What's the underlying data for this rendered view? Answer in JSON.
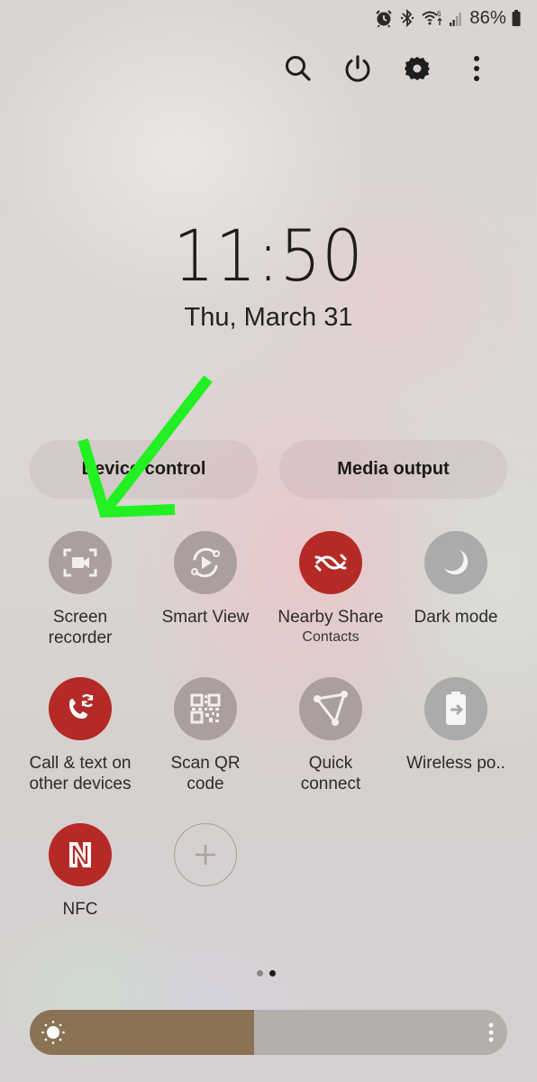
{
  "status_bar": {
    "icons": [
      "alarm-icon",
      "bluetooth-icon",
      "wifi-6-icon",
      "cell-signal-icon",
      "battery-icon"
    ],
    "battery_percent": "86%"
  },
  "top_actions": [
    {
      "icon": "search-icon",
      "label": "Search"
    },
    {
      "icon": "power-icon",
      "label": "Power"
    },
    {
      "icon": "gear-icon",
      "label": "Settings"
    },
    {
      "icon": "more-vert-icon",
      "label": "More options"
    }
  ],
  "clock": {
    "time": "11:50",
    "date": "Thu, March 31"
  },
  "pills": {
    "device_control": "Device control",
    "media_output": "Media output"
  },
  "tiles": [
    {
      "label": "Screen",
      "label2": "recorder",
      "sub": "",
      "icon": "screen-recorder-icon",
      "state": "off"
    },
    {
      "label": "Smart View",
      "label2": "",
      "sub": "",
      "icon": "smart-view-icon",
      "state": "off"
    },
    {
      "label": "Nearby Share",
      "label2": "",
      "sub": "Contacts",
      "icon": "nearby-share-icon",
      "state": "on"
    },
    {
      "label": "Dark mode",
      "label2": "",
      "sub": "",
      "icon": "moon-icon",
      "state": "off"
    },
    {
      "label": "Call & text on",
      "label2": "other devices",
      "sub": "",
      "icon": "call-sync-icon",
      "state": "on"
    },
    {
      "label": "Scan QR",
      "label2": "code",
      "sub": "",
      "icon": "qr-code-icon",
      "state": "off"
    },
    {
      "label": "Quick",
      "label2": "connect",
      "sub": "",
      "icon": "quick-connect-icon",
      "state": "off"
    },
    {
      "label": "Wireless po..",
      "label2": "",
      "sub": "",
      "icon": "wireless-powershare-icon",
      "state": "off"
    },
    {
      "label": "NFC",
      "label2": "",
      "sub": "",
      "icon": "nfc-icon",
      "state": "on"
    },
    {
      "label": "",
      "label2": "",
      "sub": "",
      "icon": "add-icon",
      "state": "add"
    }
  ],
  "page_indicator": {
    "total": 2,
    "current": 2
  },
  "brightness": {
    "level_percent": 47
  },
  "colors": {
    "tile_on": "#b52a26",
    "tile_off": "#ab9e9e",
    "brightness_fill": "#8a7254",
    "annotation_arrow": "#22f022"
  },
  "annotation": {
    "type": "arrow",
    "points_to": "Screen recorder"
  }
}
